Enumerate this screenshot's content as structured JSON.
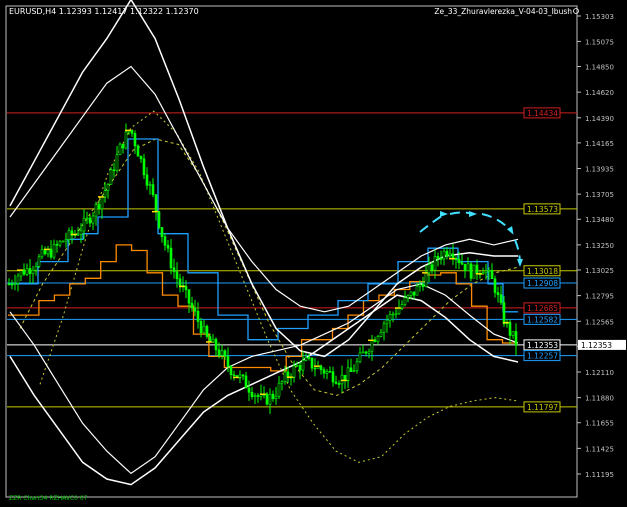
{
  "header": {
    "symbol_info": "EURUSD,H4  1.12393 1.12417 1.12322 1.12370",
    "indicator_name": "Ze_33_Zhuravlerezka_V-04-03_Ibush"
  },
  "footer": {
    "text": "ZZR  Chart34  RZHAVC0  07"
  },
  "colors": {
    "background": "#000000",
    "axis": "#c0c0c0",
    "candles": "#00ff00",
    "price_marker": "#ffffff",
    "envelope": "#ffffff",
    "channel_blue": "#1ea0ff",
    "channel_orange": "#ff8c00",
    "midline": "#c8c832",
    "level_red": "#d02020",
    "level_yellow": "#c8c800",
    "arrows": "#40e0ff"
  },
  "chart_data": {
    "type": "line",
    "title": "EURUSD,H4",
    "ylim": [
      1.11,
      1.1545
    ],
    "price_ticks": [
      "1.15303",
      "1.15075",
      "1.14850",
      "1.14620",
      "1.14390",
      "1.14165",
      "1.13935",
      "1.13705",
      "1.13480",
      "1.13250",
      "1.13025",
      "1.12795",
      "1.12565",
      "1.12340",
      "1.12110",
      "1.11880",
      "1.11655",
      "1.11425",
      "1.11195"
    ],
    "price_tick_values": [
      1.15303,
      1.15075,
      1.1485,
      1.1462,
      1.1439,
      1.14165,
      1.13935,
      1.13705,
      1.1348,
      1.1325,
      1.13025,
      1.12795,
      1.12565,
      1.1234,
      1.1211,
      1.1188,
      1.11655,
      1.11425,
      1.11195
    ],
    "levels": [
      {
        "label": "1.14434",
        "value": 1.14434,
        "color": "red"
      },
      {
        "label": "1.13573",
        "value": 1.13573,
        "color": "yellow"
      },
      {
        "label": "1.13018",
        "value": 1.13018,
        "color": "yellow"
      },
      {
        "label": "1.12908",
        "value": 1.12908,
        "color": "blue"
      },
      {
        "label": "1.12685",
        "value": 1.12685,
        "color": "red"
      },
      {
        "label": "1.12582",
        "value": 1.12582,
        "color": "blue"
      },
      {
        "label": "1.12353",
        "value": 1.12353,
        "color": "current"
      },
      {
        "label": "1.12257",
        "value": 1.12257,
        "color": "blue"
      },
      {
        "label": "1.11797",
        "value": 1.11797,
        "color": "yellow"
      }
    ],
    "close_series": [
      1.129,
      1.13,
      1.1305,
      1.1315,
      1.132,
      1.133,
      1.1335,
      1.1345,
      1.136,
      1.138,
      1.141,
      1.143,
      1.14,
      1.137,
      1.133,
      1.13,
      1.128,
      1.126,
      1.124,
      1.123,
      1.1215,
      1.1205,
      1.1195,
      1.1185,
      1.119,
      1.1205,
      1.1215,
      1.122,
      1.1215,
      1.121,
      1.1205,
      1.121,
      1.1225,
      1.124,
      1.1255,
      1.1265,
      1.1275,
      1.1285,
      1.13,
      1.1315,
      1.1322,
      1.131,
      1.13,
      1.1305,
      1.129,
      1.1255,
      1.1237
    ],
    "envelope_upper": [
      1.135,
      1.138,
      1.141,
      1.144,
      1.147,
      1.1485,
      1.146,
      1.142,
      1.138,
      1.134,
      1.131,
      1.1285,
      1.127,
      1.1265,
      1.127,
      1.1285,
      1.13,
      1.1315,
      1.1325,
      1.133,
      1.1325,
      1.133
    ],
    "envelope_lower": [
      1.1265,
      1.1235,
      1.12,
      1.1165,
      1.114,
      1.112,
      1.1135,
      1.1165,
      1.1195,
      1.1215,
      1.1225,
      1.123,
      1.1235,
      1.1245,
      1.1255,
      1.127,
      1.1285,
      1.129,
      1.128,
      1.1262,
      1.1245,
      1.1237
    ],
    "envelope_outer_upper": [
      1.136,
      1.14,
      1.144,
      1.148,
      1.151,
      1.1545,
      1.151,
      1.1455,
      1.1395,
      1.134,
      1.129,
      1.125,
      1.123,
      1.1225,
      1.124,
      1.1265,
      1.129,
      1.1305,
      1.1315,
      1.1318,
      1.1315,
      1.1315
    ],
    "envelope_outer_lower": [
      1.1225,
      1.119,
      1.116,
      1.113,
      1.1115,
      1.111,
      1.1125,
      1.115,
      1.1175,
      1.119,
      1.12,
      1.121,
      1.122,
      1.1235,
      1.125,
      1.1265,
      1.128,
      1.1275,
      1.126,
      1.124,
      1.1225,
      1.122
    ],
    "channel_blue": [
      1.129,
      1.129,
      1.131,
      1.131,
      1.133,
      1.1335,
      1.135,
      1.135,
      1.142,
      1.142,
      1.1335,
      1.1335,
      1.13,
      1.13,
      1.1262,
      1.1262,
      1.124,
      1.124,
      1.125,
      1.125,
      1.1262,
      1.1262,
      1.1275,
      1.1275,
      1.129,
      1.129,
      1.131,
      1.131,
      1.1322,
      1.1322,
      1.131,
      1.131,
      1.129,
      1.1265
    ],
    "channel_orange": [
      1.1262,
      1.1262,
      1.1275,
      1.128,
      1.129,
      1.1295,
      1.131,
      1.1325,
      1.132,
      1.13,
      1.128,
      1.127,
      1.1245,
      1.1225,
      1.1215,
      1.1215,
      1.1215,
      1.1212,
      1.1225,
      1.124,
      1.124,
      1.125,
      1.1262,
      1.1275,
      1.128,
      1.1285,
      1.1292,
      1.1298,
      1.13,
      1.129,
      1.127,
      1.124,
      1.1237
    ],
    "midline": [
      1.125,
      1.129,
      1.132,
      1.135,
      1.138,
      1.141,
      1.142,
      1.1415,
      1.1385,
      1.1345,
      1.13,
      1.1255,
      1.122,
      1.1195,
      1.119,
      1.12,
      1.1215,
      1.1235,
      1.1255,
      1.1275,
      1.129,
      1.13,
      1.1305
    ],
    "midline_outer": [
      1.12,
      1.126,
      1.133,
      1.139,
      1.143,
      1.1445,
      1.1425,
      1.139,
      1.134,
      1.129,
      1.124,
      1.1195,
      1.1165,
      1.114,
      1.113,
      1.1135,
      1.1155,
      1.117,
      1.118,
      1.1185,
      1.1188,
      1.1185
    ]
  }
}
